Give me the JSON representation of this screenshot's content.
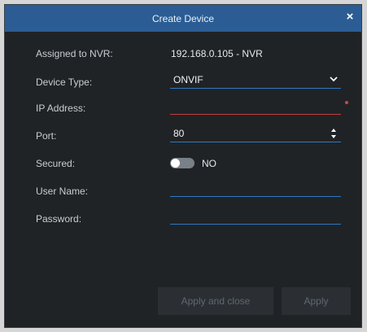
{
  "dialog": {
    "title": "Create Device",
    "close_icon": "×"
  },
  "form": {
    "assigned_to_nvr": {
      "label": "Assigned to NVR:",
      "value": "192.168.0.105 - NVR"
    },
    "device_type": {
      "label": "Device Type:",
      "value": "ONVIF"
    },
    "ip_address": {
      "label": "IP Address:",
      "value": ""
    },
    "port": {
      "label": "Port:",
      "value": "80"
    },
    "secured": {
      "label": "Secured:",
      "value": "NO"
    },
    "user_name": {
      "label": "User Name:",
      "value": ""
    },
    "password": {
      "label": "Password:",
      "value": ""
    }
  },
  "buttons": {
    "apply_close": "Apply and close",
    "apply": "Apply"
  }
}
